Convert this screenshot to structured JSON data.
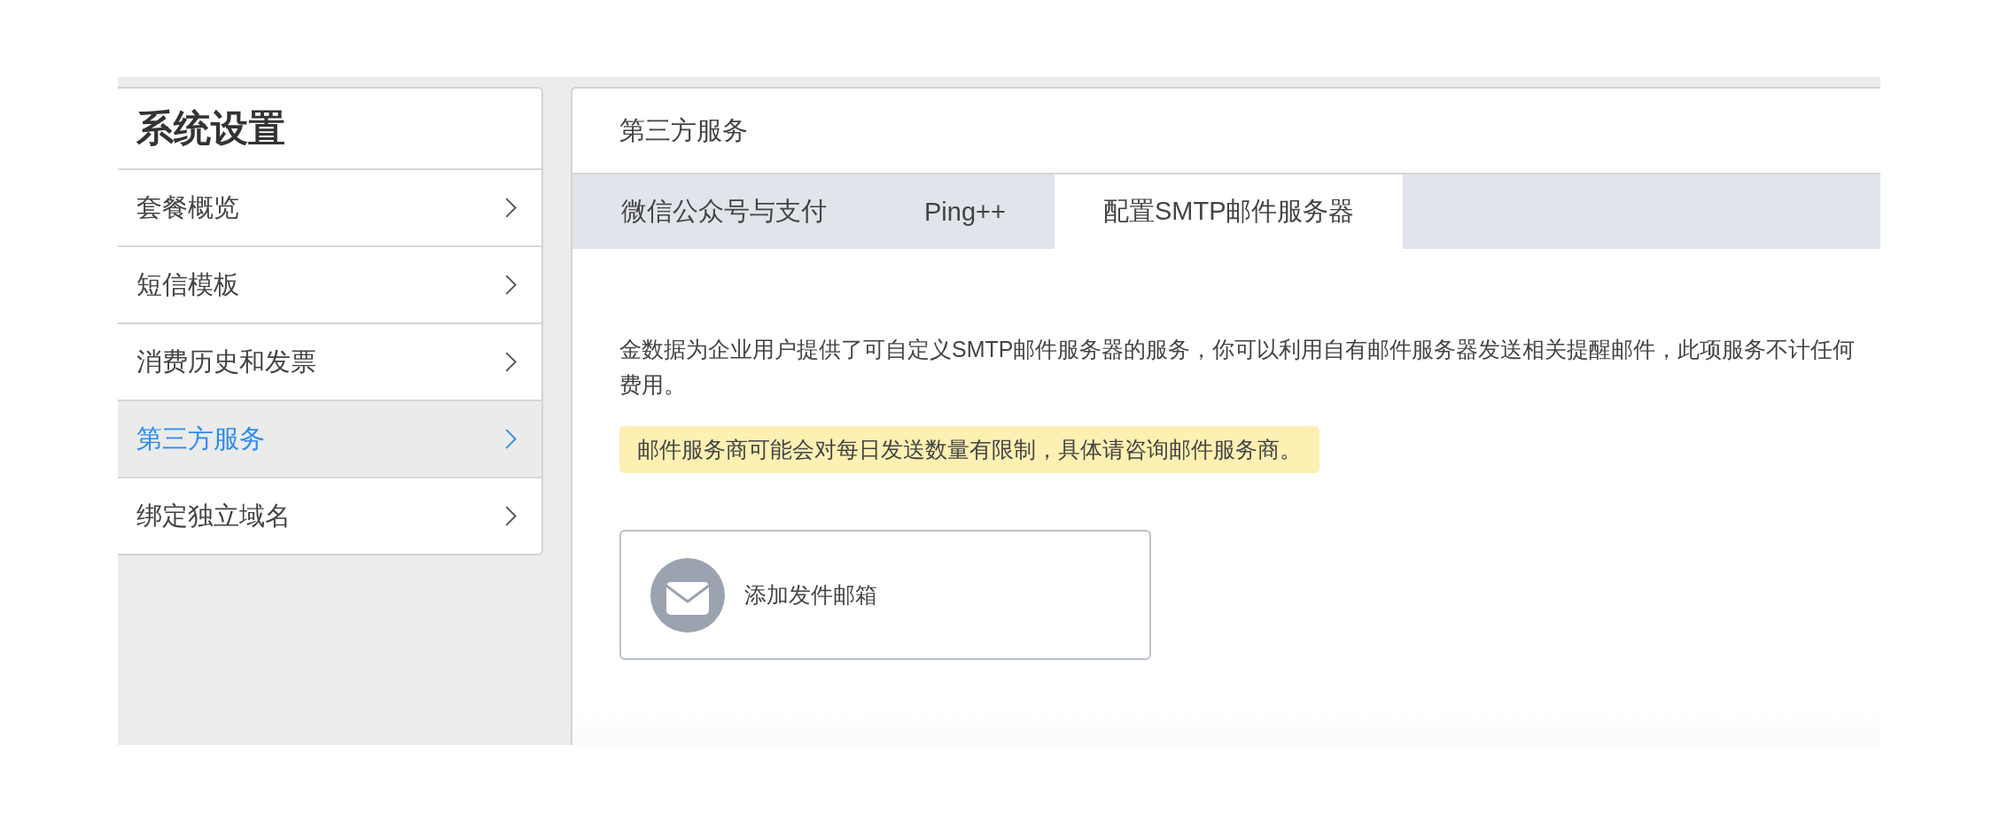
{
  "sidebar": {
    "title": "系统设置",
    "items": [
      {
        "label": "套餐概览",
        "selected": false
      },
      {
        "label": "短信模板",
        "selected": false
      },
      {
        "label": "消费历史和发票",
        "selected": false
      },
      {
        "label": "第三方服务",
        "selected": true
      },
      {
        "label": "绑定独立域名",
        "selected": false
      }
    ]
  },
  "panel": {
    "title": "第三方服务",
    "tabs": [
      {
        "label": "微信公众号与支付",
        "selected": false
      },
      {
        "label": "Ping++",
        "selected": false
      },
      {
        "label": "配置SMTP邮件服务器",
        "selected": true
      }
    ],
    "description": "金数据为企业用户提供了可自定义SMTP邮件服务器的服务，你可以利用自有邮件服务器发送相关提醒邮件，此项服务不计任何费用。",
    "notice": "邮件服务商可能会对每日发送数量有限制，具体请咨询邮件服务商。",
    "add_card": {
      "label": "添加发件邮箱"
    }
  }
}
